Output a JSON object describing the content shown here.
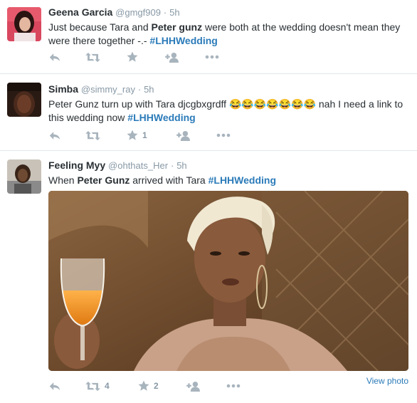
{
  "tweets": [
    {
      "name": "Geena Garcia",
      "handle": "@gmgf909",
      "separator": "·",
      "time": "5h",
      "text_parts": [
        "Just because Tara and ",
        "Peter gunz",
        " were both at the wedding doesn't mean they were there together -.- ",
        "#LHHWedding"
      ],
      "actions": {
        "reply": "",
        "retweet": "",
        "favorite": "",
        "follow": "",
        "more": ""
      }
    },
    {
      "name": "Simba",
      "handle": "@simmy_ray",
      "separator": "·",
      "time": "5h",
      "text_parts": [
        "Peter Gunz turn up with Tara djcgbxgrdff ",
        "😂😂😂😂😂😂😂",
        " nah I need a link to this wedding now ",
        "#LHHWedding"
      ],
      "actions": {
        "reply": "",
        "retweet": "",
        "favorite": "1",
        "follow": "",
        "more": ""
      }
    },
    {
      "name": "Feeling Myy",
      "handle": "@ohthats_Her",
      "separator": "·",
      "time": "5h",
      "text_parts": [
        "When ",
        "Peter Gunz",
        " arrived with Tara ",
        "#LHHWedding"
      ],
      "view_photo": "View photo",
      "actions": {
        "reply": "",
        "retweet": "4",
        "favorite": "2",
        "follow": "",
        "more": ""
      }
    }
  ],
  "icons": {
    "reply": "reply-icon",
    "retweet": "retweet-icon",
    "favorite": "star-icon",
    "follow": "follow-icon",
    "more": "more-icon"
  },
  "colors": {
    "link": "#2b7bb9",
    "meta": "#8899a6",
    "icon": "#a8b4bd",
    "divider": "#e1e8ed"
  }
}
